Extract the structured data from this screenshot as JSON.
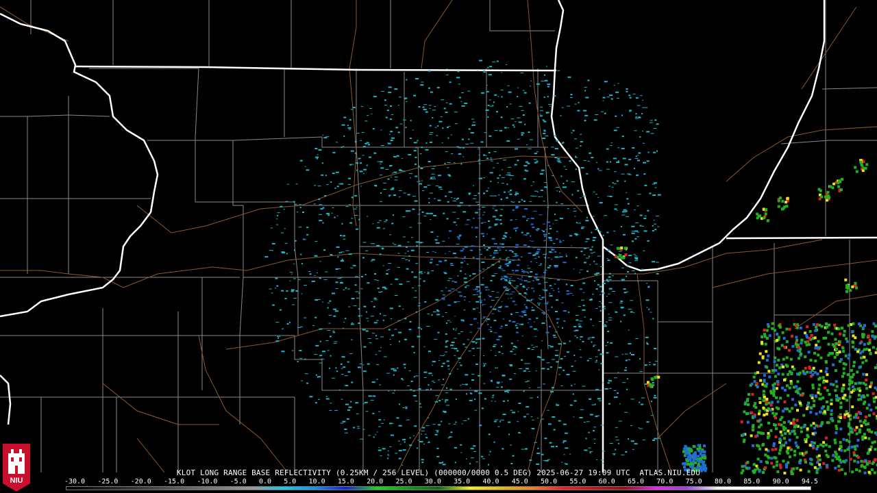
{
  "radar": {
    "title": "KLOT LONG RANGE BASE REFLECTIVITY (0.25KM / 256 LEVEL) (000000/0000 0.5 DEG) 2025-06-27 19:09 UTC  ATLAS.NIU.EDU",
    "logo_text": "NIU",
    "colors": {
      "background": "#000000",
      "state_border": "#ffffff",
      "county_border": "#8a8a8a",
      "road": "#8b5a2b",
      "light_echo": "#1fb6c8",
      "moderate_echo": "#1f6ed8",
      "green_echo": "#21b021",
      "yellow_echo": "#e8e020",
      "red_echo": "#e02020",
      "logo_red": "#c8102e"
    }
  },
  "scale": {
    "labels": [
      "-30.0",
      "-25.0",
      "-20.0",
      "-15.0",
      "-10.0",
      "-5.0",
      "0.0",
      "5.0",
      "10.0",
      "15.0",
      "20.0",
      "25.0",
      "30.0",
      "35.0",
      "40.0",
      "45.0",
      "50.0",
      "55.0",
      "60.0",
      "65.0",
      "70.0",
      "75.0",
      "80.0",
      "85.0",
      "90.0",
      "94.5"
    ],
    "gradient": [
      "#000000",
      "#1a1a1a",
      "#303030",
      "#4a4a4a",
      "#666666",
      "#808080",
      "#9a9a9a",
      "#18c8e8",
      "#1890f0",
      "#1020e0",
      "#18d818",
      "#10a010",
      "#0a6a0a",
      "#f0f020",
      "#e8b818",
      "#f08020",
      "#f02020",
      "#c01818",
      "#901010",
      "#f020f0",
      "#a040e0",
      "#f0f0f0",
      "#ffffff",
      "#ffffff",
      "#ffffff"
    ]
  }
}
